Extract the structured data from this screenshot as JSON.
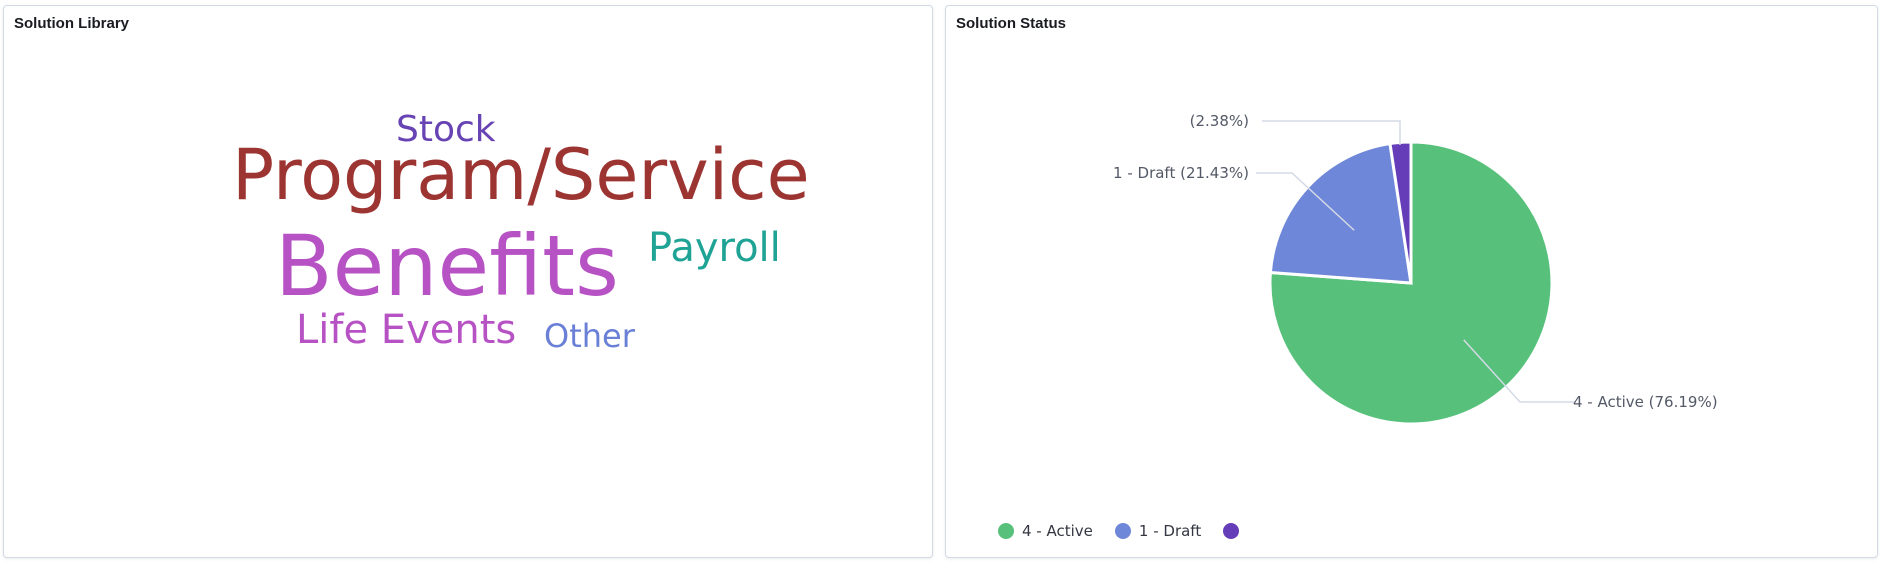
{
  "panels": {
    "library": {
      "title": "Solution Library"
    },
    "status": {
      "title": "Solution Status"
    }
  },
  "word_cloud": {
    "words": [
      {
        "text": "Stock",
        "color": "#6743b3"
      },
      {
        "text": "Program/Service",
        "color": "#9c3532"
      },
      {
        "text": "Benefits",
        "color": "#b752c4"
      },
      {
        "text": "Payroll",
        "color": "#1ea395"
      },
      {
        "text": "Life Events",
        "color": "#b752c4"
      },
      {
        "text": "Other",
        "color": "#6a80d6"
      }
    ]
  },
  "chart_data": {
    "type": "pie",
    "slices": [
      {
        "name": "4 - Active",
        "percent": 76.19,
        "label": "4 - Active (76.19%)",
        "color": "#57c17b"
      },
      {
        "name": "1 - Draft",
        "percent": 21.43,
        "label": "1 - Draft (21.43%)",
        "color": "#6f87d8"
      },
      {
        "name": "",
        "percent": 2.38,
        "label": "(2.38%)",
        "color": "#663db8"
      }
    ],
    "legend_position": "bottom-left"
  },
  "legend": {
    "items": [
      {
        "label": "4 - Active",
        "color": "#57c17b"
      },
      {
        "label": "1 - Draft",
        "color": "#6f87d8"
      },
      {
        "label": "",
        "color": "#663db8"
      }
    ]
  }
}
